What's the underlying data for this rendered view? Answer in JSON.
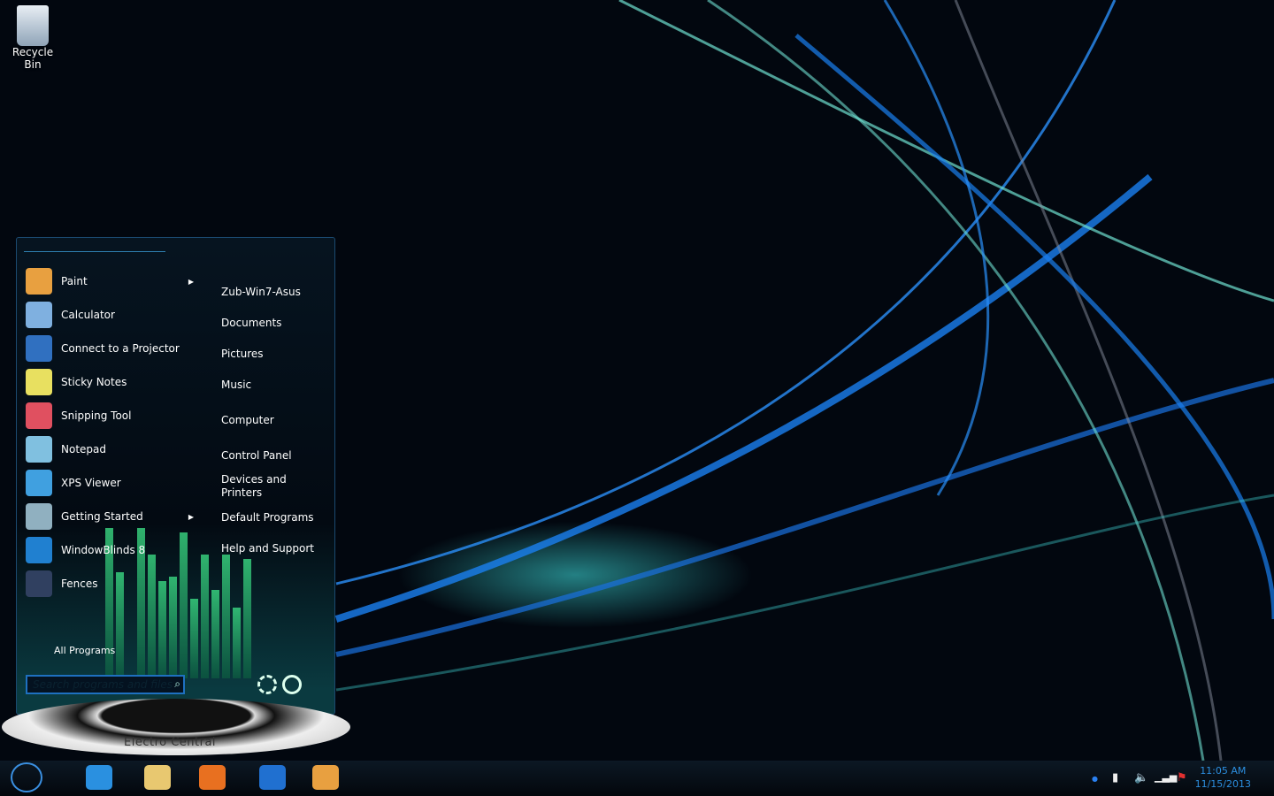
{
  "desktop": {
    "icons": [
      {
        "label": "Recycle Bin",
        "icon": "recycle-bin-icon"
      }
    ]
  },
  "start_menu": {
    "programs": [
      {
        "label": "Paint",
        "icon": "paint-icon",
        "submenu": true,
        "color": "#e8a040"
      },
      {
        "label": "Calculator",
        "icon": "calculator-icon",
        "submenu": false,
        "color": "#7fb0e0"
      },
      {
        "label": "Connect to a Projector",
        "icon": "projector-icon",
        "submenu": false,
        "color": "#3070c0"
      },
      {
        "label": "Sticky Notes",
        "icon": "sticky-notes-icon",
        "submenu": false,
        "color": "#e8e060"
      },
      {
        "label": "Snipping Tool",
        "icon": "scissors-icon",
        "submenu": false,
        "color": "#e05060"
      },
      {
        "label": "Notepad",
        "icon": "notepad-icon",
        "submenu": false,
        "color": "#80c0e0"
      },
      {
        "label": "XPS Viewer",
        "icon": "xps-viewer-icon",
        "submenu": false,
        "color": "#40a0e0"
      },
      {
        "label": "Getting Started",
        "icon": "getting-started-icon",
        "submenu": true,
        "color": "#90b0c0"
      },
      {
        "label": "WindowBlinds 8",
        "icon": "windowblinds-icon",
        "submenu": false,
        "color": "#2080d0"
      },
      {
        "label": "Fences",
        "icon": "fences-icon",
        "submenu": false,
        "color": "#304060"
      }
    ],
    "all_programs": "All Programs",
    "search_placeholder": "Search programs and files",
    "places": [
      "Zub-Win7-Asus",
      "Documents",
      "Pictures",
      "Music",
      "Computer",
      "Control Panel",
      "Devices and\nPrinters",
      "Default Programs",
      "Help and Support"
    ],
    "brand": "Electro Central"
  },
  "taskbar": {
    "pinned": [
      {
        "name": "internet-explorer",
        "color": "#2a90e0"
      },
      {
        "name": "file-explorer",
        "color": "#e8c870"
      },
      {
        "name": "media-player",
        "color": "#e87020"
      },
      {
        "name": "windowblinds",
        "color": "#2070d0"
      },
      {
        "name": "paint",
        "color": "#e8a040"
      }
    ],
    "time": "11:05 AM",
    "date": "11/15/2013"
  }
}
